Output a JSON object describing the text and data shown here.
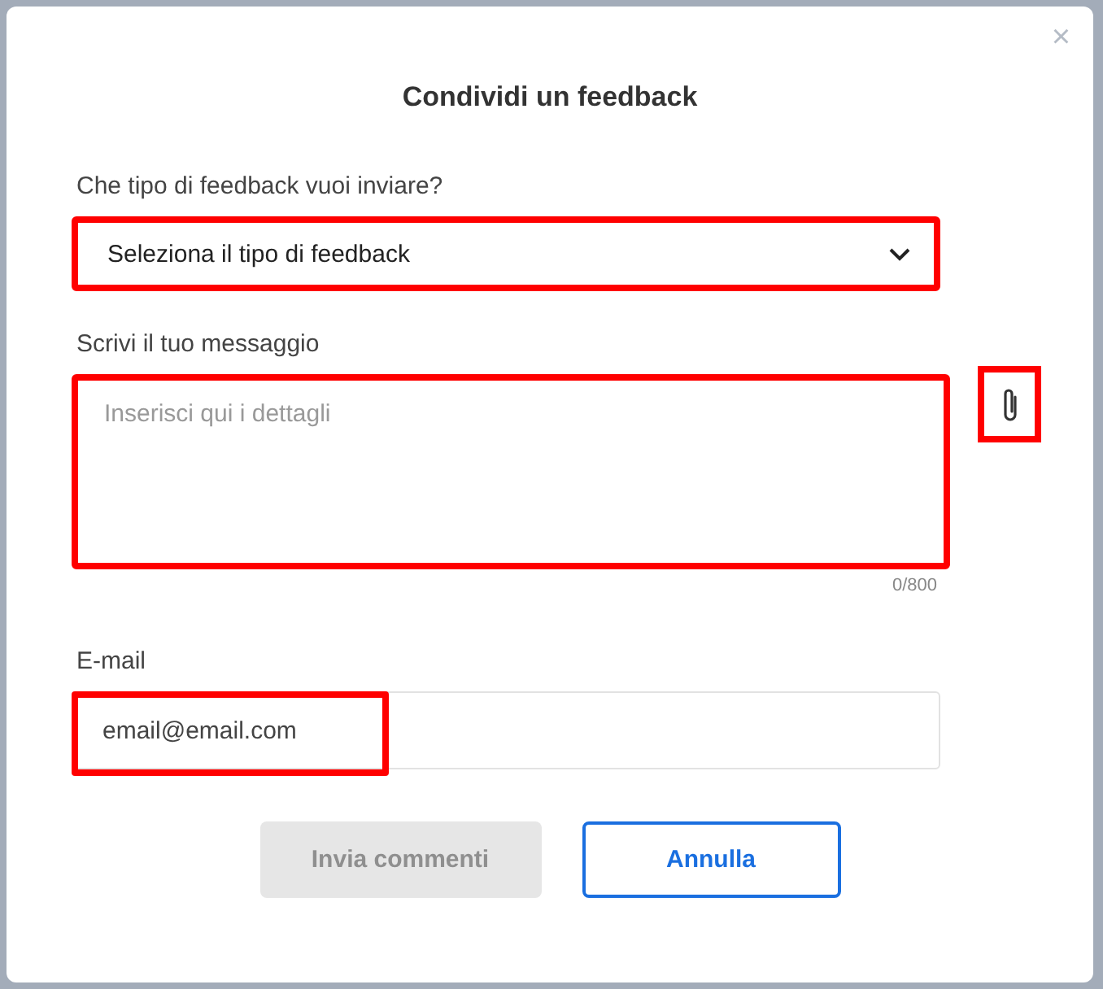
{
  "dialog": {
    "title": "Condividi un feedback",
    "close": "×"
  },
  "type_field": {
    "label": "Che tipo di feedback vuoi inviare?",
    "value": "Seleziona il tipo di feedback",
    "highlighted": true
  },
  "message_field": {
    "label": "Scrivi il tuo messaggio",
    "placeholder": "Inserisci qui i dettagli",
    "counter": "0/800",
    "highlighted": true
  },
  "attach_button": {
    "highlighted": true
  },
  "email_field": {
    "label": "E-mail",
    "value": "email@email.com",
    "highlighted": true
  },
  "buttons": [
    {
      "label": "Invia commenti",
      "kind": "primary",
      "disabled": true
    },
    {
      "label": "Annulla",
      "kind": "secondary",
      "disabled": false
    }
  ]
}
